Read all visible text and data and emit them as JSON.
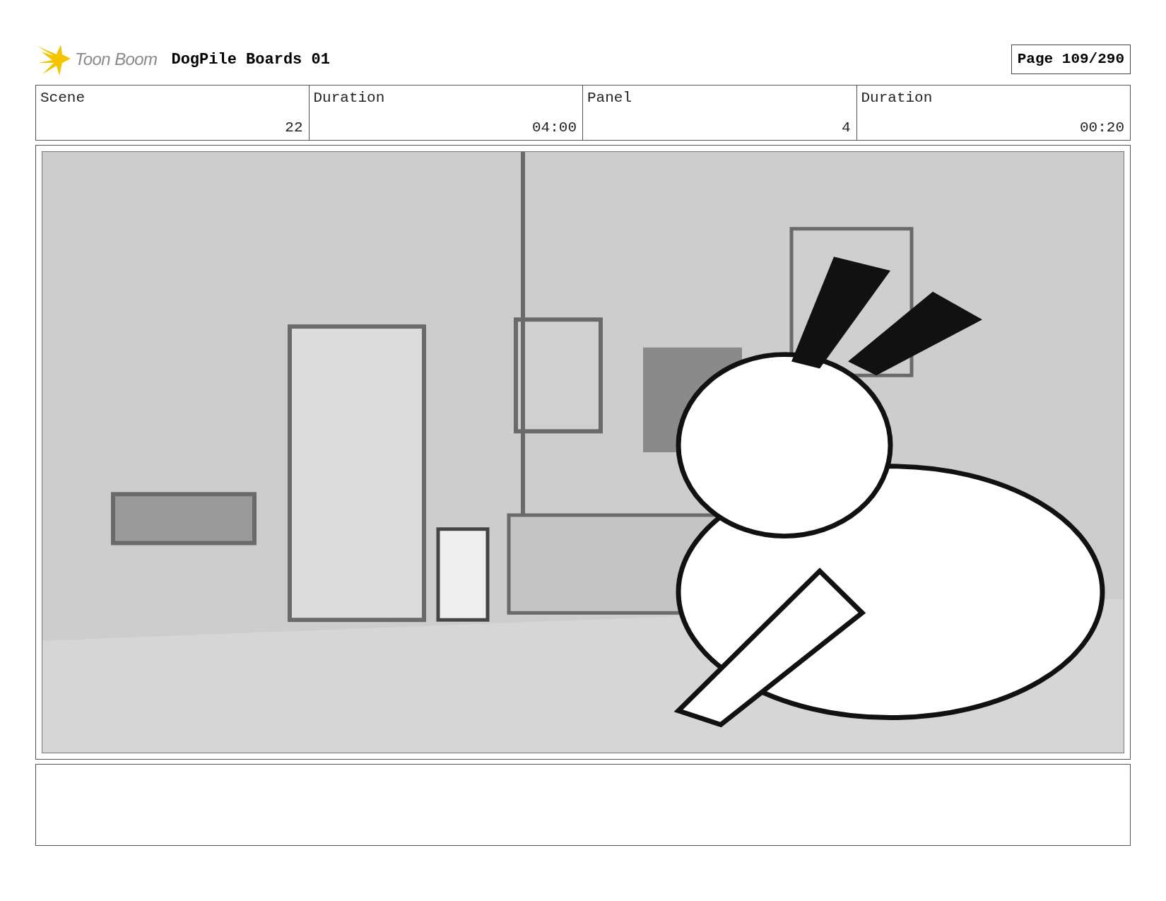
{
  "header": {
    "logo_text": "Toon Boom",
    "project_title": "DogPile Boards 01",
    "page": "Page 109/290"
  },
  "info_cells": [
    {
      "caption": "Scene",
      "entry": "22"
    },
    {
      "caption": "Duration",
      "entry": "04:00"
    },
    {
      "caption": "Panel",
      "entry": "4"
    },
    {
      "caption": "Duration",
      "entry": "00:20"
    }
  ]
}
